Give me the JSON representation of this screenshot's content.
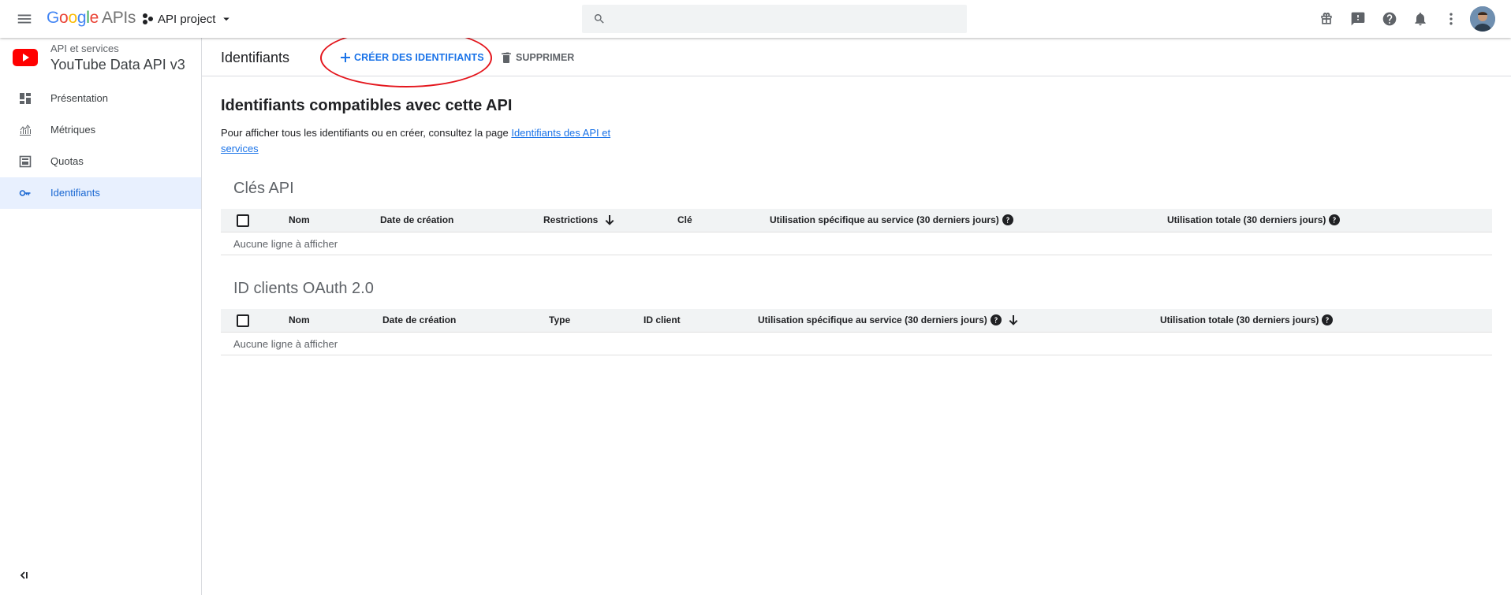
{
  "topbar": {
    "logo": {
      "g1": "G",
      "g2": "o",
      "g3": "o",
      "g4": "g",
      "g5": "l",
      "g6": "e",
      "apis": "APIs"
    },
    "project_name": "API project",
    "search_placeholder": "",
    "icons": [
      "gift-icon",
      "feedback-icon",
      "help-icon",
      "notifications-icon",
      "more-vert-icon"
    ]
  },
  "sidebar": {
    "api_subtitle": "API et services",
    "api_title": "YouTube Data API v3",
    "items": [
      {
        "label": "Présentation",
        "icon": "dashboard-icon",
        "active": false
      },
      {
        "label": "Métriques",
        "icon": "metrics-icon",
        "active": false
      },
      {
        "label": "Quotas",
        "icon": "quotas-icon",
        "active": false
      },
      {
        "label": "Identifiants",
        "icon": "key-icon",
        "active": true
      }
    ]
  },
  "header": {
    "title": "Identifiants",
    "create_label": "CRÉER DES IDENTIFIANTS",
    "delete_label": "SUPPRIMER"
  },
  "content": {
    "section_title": "Identifiants compatibles avec cette API",
    "intro_text": "Pour afficher tous les identifiants ou en créer, consultez la page ",
    "intro_link": "Identifiants des API et services",
    "api_keys": {
      "title": "Clés API",
      "columns": [
        "Nom",
        "Date de création",
        "Restrictions",
        "Clé",
        "Utilisation spécifique au service (30 derniers jours)",
        "Utilisation totale (30 derniers jours)"
      ],
      "empty": "Aucune ligne à afficher"
    },
    "oauth": {
      "title": "ID clients OAuth 2.0",
      "columns": [
        "Nom",
        "Date de création",
        "Type",
        "ID client",
        "Utilisation spécifique au service (30 derniers jours)",
        "Utilisation totale (30 derniers jours)"
      ],
      "empty": "Aucune ligne à afficher"
    }
  },
  "colors": {
    "accent": "#1a73e8",
    "active_bg": "#e8f0fe",
    "highlight_circle": "#e4161d",
    "youtube_red": "#ff0000"
  }
}
